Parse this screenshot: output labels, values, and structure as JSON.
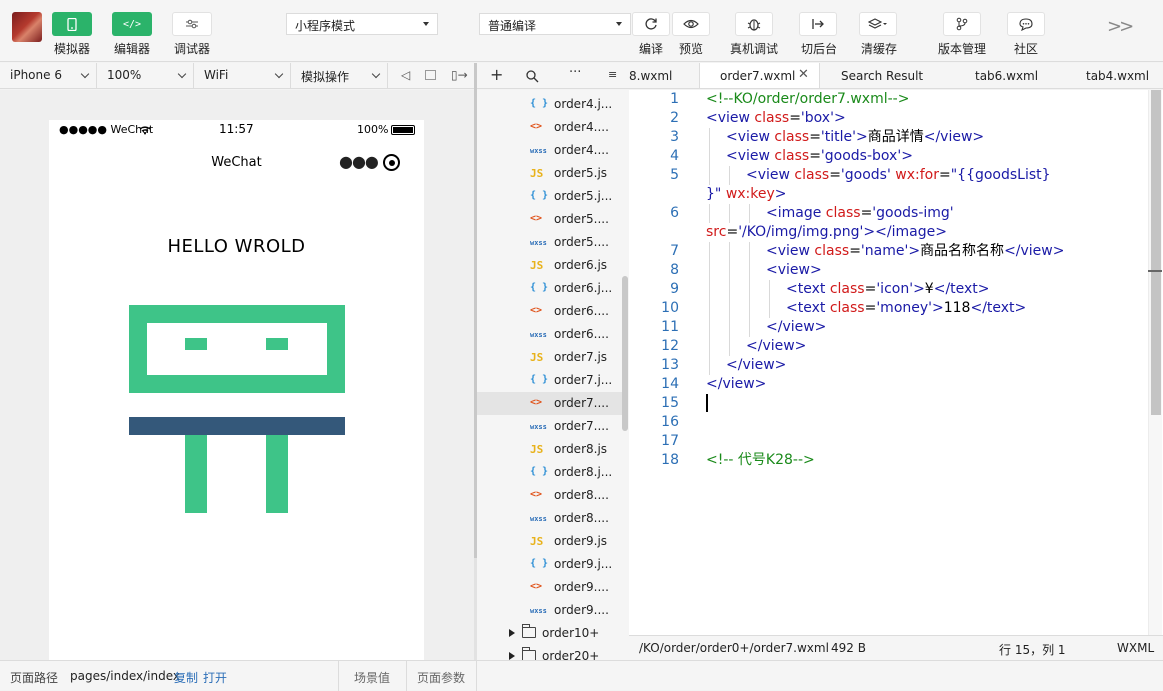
{
  "toolbar": {
    "simulator_label": "模拟器",
    "editor_label": "编辑器",
    "debugger_label": "调试器",
    "mode_select": "小程序模式",
    "compile_select": "普通编译",
    "compile_label": "编译",
    "preview_label": "预览",
    "remote_debug_label": "真机调试",
    "background_label": "切后台",
    "clear_cache_label": "清缓存",
    "version_label": "版本管理",
    "community_label": "社区"
  },
  "sim_bar": {
    "device": "iPhone 6",
    "zoom": "100%",
    "network": "WiFi",
    "ops": "模拟操作"
  },
  "phone": {
    "carrier": "●●●●● WeChat",
    "time": "11:57",
    "battery": "100%",
    "nav_title": "WeChat",
    "heading": "HELLO WROLD",
    "colors": {
      "green": "#3ec488",
      "navy": "#34587a"
    }
  },
  "tree": {
    "files": [
      {
        "icon": "json",
        "name": "order4.j..."
      },
      {
        "icon": "wxml",
        "name": "order4...."
      },
      {
        "icon": "wxss",
        "name": "order4...."
      },
      {
        "icon": "js",
        "name": "order5.js"
      },
      {
        "icon": "json",
        "name": "order5.j..."
      },
      {
        "icon": "wxml",
        "name": "order5...."
      },
      {
        "icon": "wxss",
        "name": "order5...."
      },
      {
        "icon": "js",
        "name": "order6.js"
      },
      {
        "icon": "json",
        "name": "order6.j..."
      },
      {
        "icon": "wxml",
        "name": "order6...."
      },
      {
        "icon": "wxss",
        "name": "order6...."
      },
      {
        "icon": "js",
        "name": "order7.js"
      },
      {
        "icon": "json",
        "name": "order7.j..."
      },
      {
        "icon": "wxml",
        "name": "order7....",
        "active": true
      },
      {
        "icon": "wxss",
        "name": "order7...."
      },
      {
        "icon": "js",
        "name": "order8.js"
      },
      {
        "icon": "json",
        "name": "order8.j..."
      },
      {
        "icon": "wxml",
        "name": "order8...."
      },
      {
        "icon": "wxss",
        "name": "order8...."
      },
      {
        "icon": "js",
        "name": "order9.js"
      },
      {
        "icon": "json",
        "name": "order9.j..."
      },
      {
        "icon": "wxml",
        "name": "order9...."
      },
      {
        "icon": "wxss",
        "name": "order9...."
      }
    ],
    "folders": [
      "order10+",
      "order20+"
    ]
  },
  "tabs": {
    "tab0": "8.wxml",
    "tab1": "order7.wxml",
    "tab2": "Search Result",
    "tab3": "tab6.wxml",
    "tab4": "tab4.wxml"
  },
  "code_lines": [
    {
      "n": "1",
      "indent": 0,
      "html": "<span class='c-cmt'>&lt;!--KO/order/order7.wxml--&gt;</span>"
    },
    {
      "n": "2",
      "indent": 0,
      "html": "<span class='c-tag'>&lt;view</span> <span class='c-attr'>class</span>=<span class='c-str'>'box'</span><span class='c-tag'>&gt;</span>"
    },
    {
      "n": "3",
      "indent": 1,
      "html": "<span class='c-tag'>&lt;view</span> <span class='c-attr'>class</span>=<span class='c-str'>'title'</span><span class='c-tag'>&gt;</span>商品详情<span class='c-tag'>&lt;/view&gt;</span>"
    },
    {
      "n": "4",
      "indent": 1,
      "html": "<span class='c-tag'>&lt;view</span> <span class='c-attr'>class</span>=<span class='c-str'>'goods-box'</span><span class='c-tag'>&gt;</span>"
    },
    {
      "n": "5",
      "indent": 2,
      "html": "<span class='c-tag'>&lt;view</span> <span class='c-attr'>class</span>=<span class='c-str'>'goods'</span> <span class='c-attr'>wx:for</span>=<span class='c-str'>\"{{goodsList}</span>"
    },
    {
      "n": "",
      "indent": 0,
      "html": "<span class='c-str'>}\"</span> <span class='c-attr'>wx:key</span><span class='c-tag'>&gt;</span>"
    },
    {
      "n": "6",
      "indent": 3,
      "html": "<span class='c-tag'>&lt;image</span> <span class='c-attr'>class</span>=<span class='c-str'>'goods-img'</span>"
    },
    {
      "n": "",
      "indent": 0,
      "html": "<span class='c-attr'>src</span>=<span class='c-str'>'/KO/img/img.png'</span><span class='c-tag'>&gt;&lt;/image&gt;</span>"
    },
    {
      "n": "7",
      "indent": 3,
      "html": "<span class='c-tag'>&lt;view</span> <span class='c-attr'>class</span>=<span class='c-str'>'name'</span><span class='c-tag'>&gt;</span>商品名称名称<span class='c-tag'>&lt;/view&gt;</span>"
    },
    {
      "n": "8",
      "indent": 3,
      "html": "<span class='c-tag'>&lt;view&gt;</span>"
    },
    {
      "n": "9",
      "indent": 4,
      "html": "<span class='c-tag'>&lt;text</span> <span class='c-attr'>class</span>=<span class='c-str'>'icon'</span><span class='c-tag'>&gt;</span>¥<span class='c-tag'>&lt;/text&gt;</span>"
    },
    {
      "n": "10",
      "indent": 4,
      "html": "<span class='c-tag'>&lt;text</span> <span class='c-attr'>class</span>=<span class='c-str'>'money'</span><span class='c-tag'>&gt;</span>118<span class='c-tag'>&lt;/text&gt;</span>"
    },
    {
      "n": "11",
      "indent": 3,
      "html": "<span class='c-tag'>&lt;/view&gt;</span>"
    },
    {
      "n": "12",
      "indent": 2,
      "html": "<span class='c-tag'>&lt;/view&gt;</span>"
    },
    {
      "n": "13",
      "indent": 1,
      "html": "<span class='c-tag'>&lt;/view&gt;</span>"
    },
    {
      "n": "14",
      "indent": 0,
      "html": "<span class='c-tag'>&lt;/view&gt;</span>"
    },
    {
      "n": "15",
      "indent": 0,
      "html": ""
    },
    {
      "n": "16",
      "indent": 0,
      "html": ""
    },
    {
      "n": "17",
      "indent": 0,
      "html": ""
    },
    {
      "n": "18",
      "indent": 0,
      "html": "<span class='c-cmt'>&lt;!-- 代号K28--&gt;</span>"
    }
  ],
  "editor_status": {
    "path": "/KO/order/order0+/order7.wxml",
    "size": "492 B",
    "position": "行 15，列 1",
    "lang": "WXML"
  },
  "bottom": {
    "path_label": "页面路径",
    "path_value": "pages/index/index",
    "copy": "复制",
    "open": "打开",
    "scene": "场景值",
    "params": "页面参数"
  }
}
